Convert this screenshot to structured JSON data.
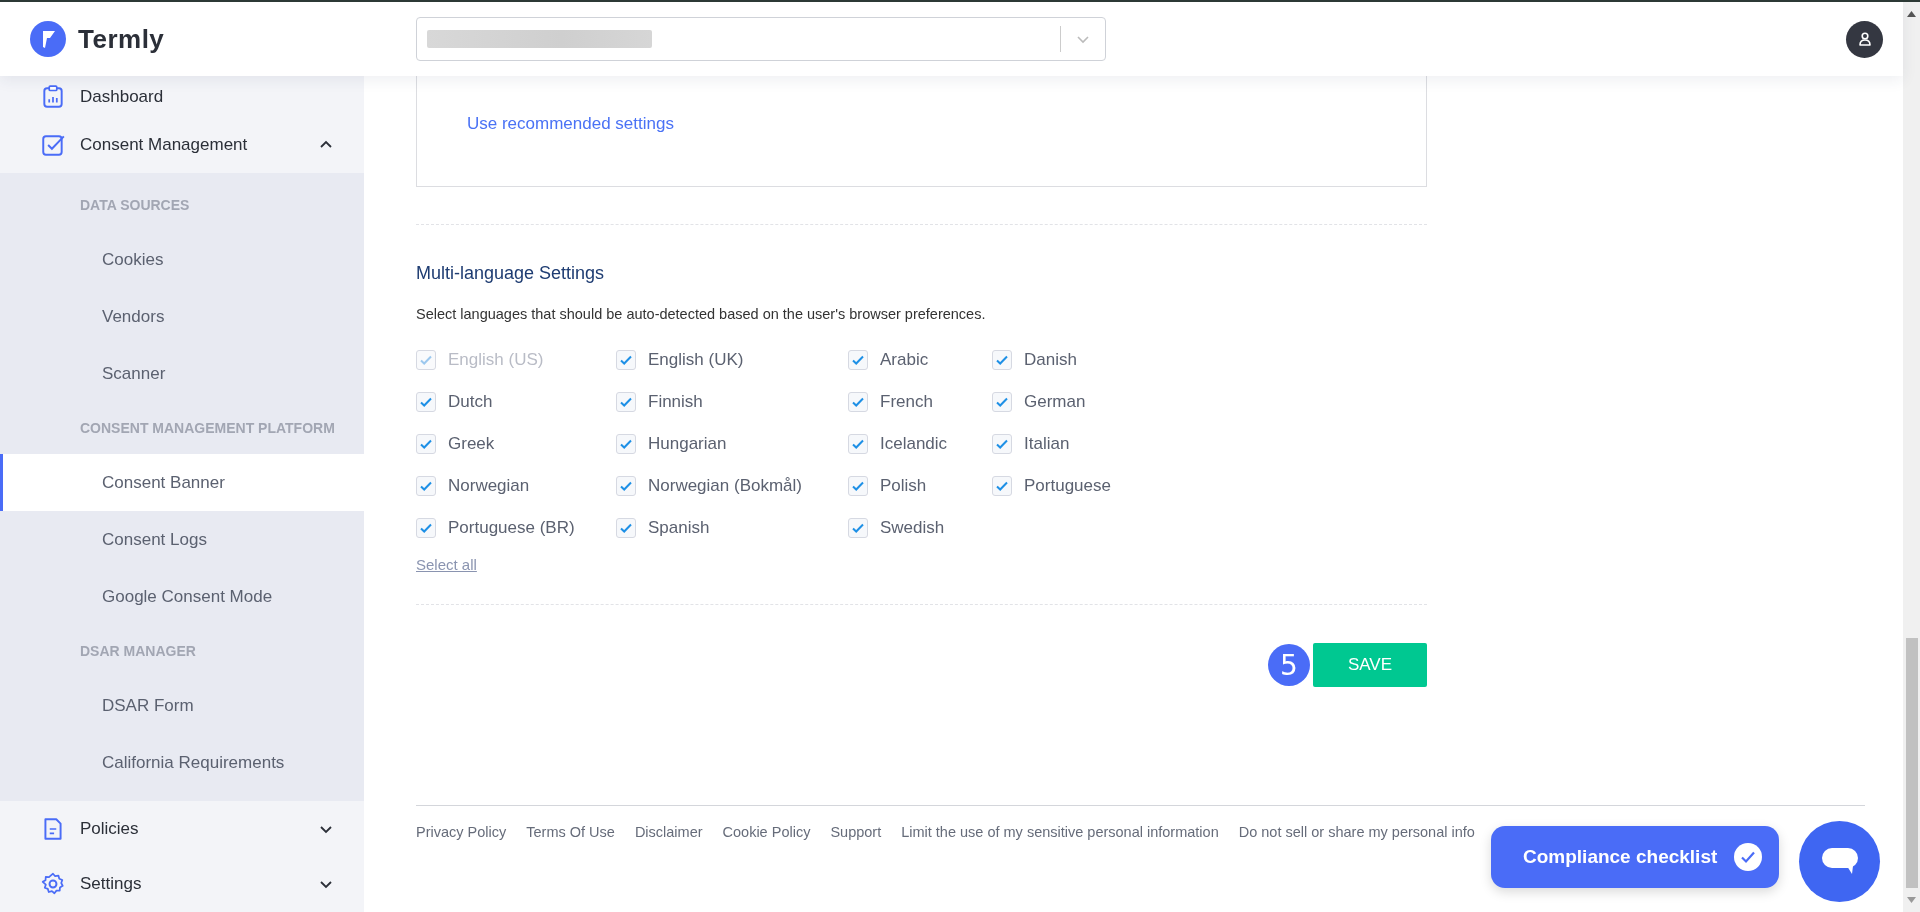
{
  "header": {
    "logo_text": "Termly"
  },
  "sidebar": {
    "items": [
      {
        "label": "Dashboard",
        "kind": "link"
      },
      {
        "label": "Consent Management",
        "kind": "group",
        "expanded": true,
        "sections": [
          {
            "heading": "DATA SOURCES",
            "items": [
              {
                "label": "Cookies",
                "selected": false
              },
              {
                "label": "Vendors",
                "selected": false
              },
              {
                "label": "Scanner",
                "selected": false
              }
            ]
          },
          {
            "heading": "CONSENT MANAGEMENT PLATFORM",
            "items": [
              {
                "label": "Consent Banner",
                "selected": true
              },
              {
                "label": "Consent Logs",
                "selected": false
              },
              {
                "label": "Google Consent Mode",
                "selected": false
              }
            ]
          },
          {
            "heading": "DSAR MANAGER",
            "items": [
              {
                "label": "DSAR Form",
                "selected": false
              },
              {
                "label": "California Requirements",
                "selected": false
              }
            ]
          }
        ]
      },
      {
        "label": "Policies",
        "kind": "group",
        "expanded": false
      },
      {
        "label": "Settings",
        "kind": "group",
        "expanded": false
      }
    ]
  },
  "card": {
    "link": "Use recommended settings"
  },
  "languages": {
    "title": "Multi-language Settings",
    "description": "Select languages that should be auto-detected based on the user's browser preferences.",
    "options": [
      {
        "label": "English (US)",
        "checked": true,
        "disabled": true
      },
      {
        "label": "English (UK)",
        "checked": true,
        "disabled": false
      },
      {
        "label": "Arabic",
        "checked": true,
        "disabled": false
      },
      {
        "label": "Danish",
        "checked": true,
        "disabled": false
      },
      {
        "label": "Dutch",
        "checked": true,
        "disabled": false
      },
      {
        "label": "Finnish",
        "checked": true,
        "disabled": false
      },
      {
        "label": "French",
        "checked": true,
        "disabled": false
      },
      {
        "label": "German",
        "checked": true,
        "disabled": false
      },
      {
        "label": "Greek",
        "checked": true,
        "disabled": false
      },
      {
        "label": "Hungarian",
        "checked": true,
        "disabled": false
      },
      {
        "label": "Icelandic",
        "checked": true,
        "disabled": false
      },
      {
        "label": "Italian",
        "checked": true,
        "disabled": false
      },
      {
        "label": "Norwegian",
        "checked": true,
        "disabled": false
      },
      {
        "label": "Norwegian (Bokmål)",
        "checked": true,
        "disabled": false
      },
      {
        "label": "Polish",
        "checked": true,
        "disabled": false
      },
      {
        "label": "Portuguese",
        "checked": true,
        "disabled": false
      },
      {
        "label": "Portuguese (BR)",
        "checked": true,
        "disabled": false
      },
      {
        "label": "Spanish",
        "checked": true,
        "disabled": false
      },
      {
        "label": "Swedish",
        "checked": true,
        "disabled": false
      }
    ],
    "select_all": "Select all"
  },
  "save": {
    "step_badge": "5",
    "label": "SAVE"
  },
  "footer": {
    "links": [
      "Privacy Policy",
      "Terms Of Use",
      "Disclaimer",
      "Cookie Policy",
      "Support",
      "Limit the use of my sensitive personal information",
      "Do not sell or share my personal info"
    ]
  },
  "compliance_button": "Compliance checklist"
}
